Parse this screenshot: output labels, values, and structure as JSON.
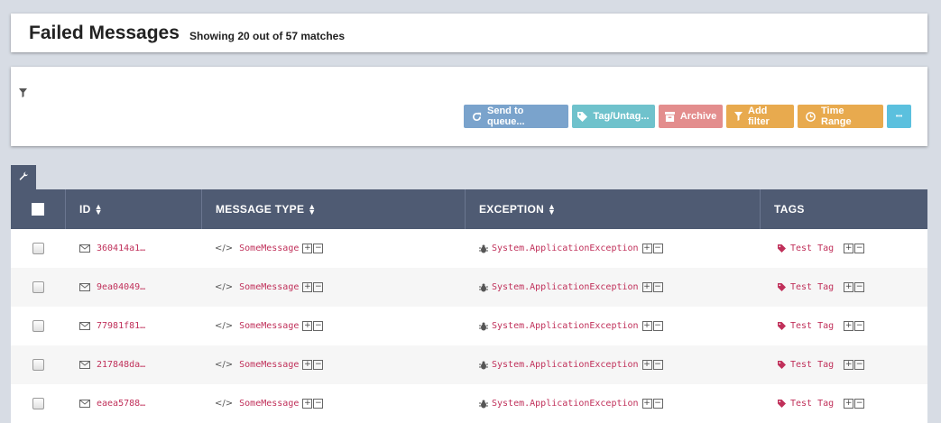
{
  "header": {
    "title": "Failed Messages",
    "subtitle": "Showing 20 out of 57 matches"
  },
  "toolbar": {
    "filter_icon": "filter-icon",
    "buttons": {
      "send_to_queue": "Send to queue...",
      "tag_untag": "Tag/Untag...",
      "archive": "Archive",
      "add_filter": "Add filter",
      "time_range": "Time Range",
      "more": "•••"
    },
    "colors": {
      "send_to_queue": "#7aa3cc",
      "tag_untag": "#6fc2cc",
      "archive": "#e38d8d",
      "add_filter": "#e8aa4e",
      "time_range": "#e8aa4e",
      "more": "#5bc0de"
    }
  },
  "table": {
    "columns": {
      "id": "ID",
      "message_type": "MESSAGE TYPE",
      "exception": "EXCEPTION",
      "tags": "TAGS"
    },
    "rows": [
      {
        "id": "360414a1…",
        "message_type": "SomeMessage",
        "exception": "System.ApplicationException",
        "tag": "Test Tag"
      },
      {
        "id": "9ea04049…",
        "message_type": "SomeMessage",
        "exception": "System.ApplicationException",
        "tag": "Test Tag"
      },
      {
        "id": "77981f81…",
        "message_type": "SomeMessage",
        "exception": "System.ApplicationException",
        "tag": "Test Tag"
      },
      {
        "id": "217848da…",
        "message_type": "SomeMessage",
        "exception": "System.ApplicationException",
        "tag": "Test Tag"
      },
      {
        "id": "eaea5788…",
        "message_type": "SomeMessage",
        "exception": "System.ApplicationException",
        "tag": "Test Tag"
      }
    ]
  },
  "theme": {
    "header_bg": "#4f5b73",
    "link_color": "#c0305a"
  }
}
